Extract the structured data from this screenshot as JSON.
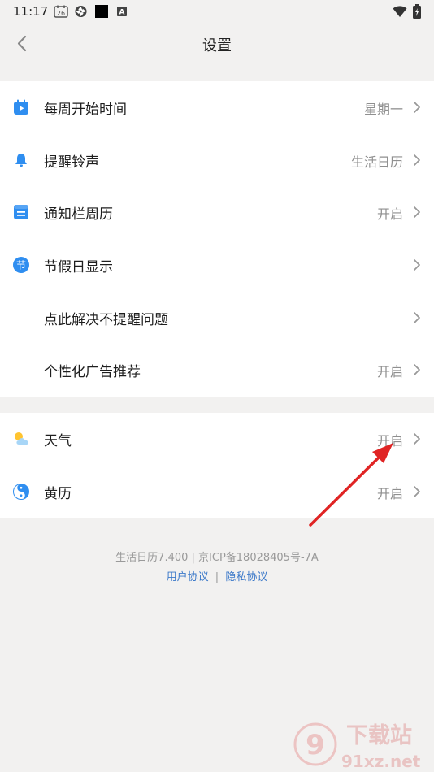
{
  "status": {
    "time": "11:17",
    "calendar_badge": "26",
    "a_badge": "A"
  },
  "header": {
    "title": "设置"
  },
  "groups": [
    {
      "items": [
        {
          "label": "每周开始时间",
          "value": "星期一",
          "icon": "calendar-play-icon"
        },
        {
          "label": "提醒铃声",
          "value": "生活日历",
          "icon": "bell-icon"
        },
        {
          "label": "通知栏周历",
          "value": "开启",
          "icon": "notification-calendar-icon"
        },
        {
          "label": "节假日显示",
          "value": "",
          "icon": "holiday-jie-icon",
          "icon_text": "节"
        },
        {
          "label": "点此解决不提醒问题",
          "value": ""
        },
        {
          "label": "个性化广告推荐",
          "value": "开启"
        }
      ]
    },
    {
      "items": [
        {
          "label": "天气",
          "value": "开启",
          "icon": "weather-icon"
        },
        {
          "label": "黄历",
          "value": "开启",
          "icon": "yinyang-icon"
        }
      ]
    }
  ],
  "footer": {
    "version_line": "生活日历7.400 | 京ICP备18028405号-7A",
    "user_agreement": "用户协议",
    "separator": "|",
    "privacy_agreement": "隐私协议"
  },
  "watermark": {
    "text": "91xz.net",
    "title": "下载站",
    "logo": "9"
  },
  "colors": {
    "accent_blue": "#2f8ef0",
    "link_blue": "#3c79c9",
    "annotation_red": "#e02424"
  }
}
